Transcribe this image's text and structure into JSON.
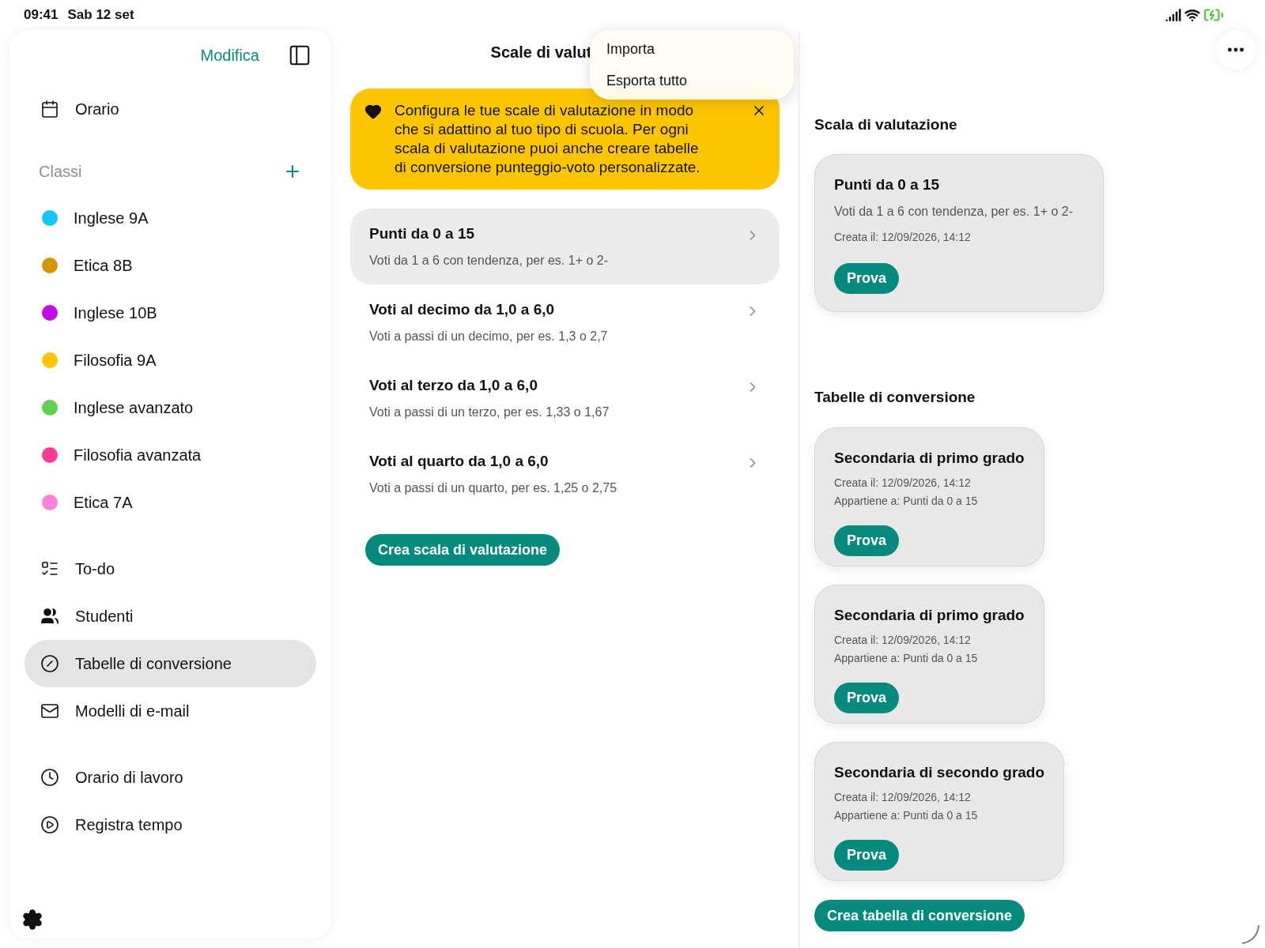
{
  "status_bar": {
    "time": "09:41",
    "date": "Sab 12 set"
  },
  "sidebar": {
    "edit_label": "Modifica",
    "top_items": [
      {
        "label": "Orario",
        "selected": false
      }
    ],
    "classes_heading": "Classi",
    "classes": [
      {
        "label": "Inglese 9A",
        "color": "#12c5fb",
        "selected": false
      },
      {
        "label": "Etica 8B",
        "color": "#d29506",
        "selected": false
      },
      {
        "label": "Inglese 10B",
        "color": "#c10ce6",
        "selected": false
      },
      {
        "label": "Filosofia 9A",
        "color": "#fec504",
        "selected": false
      },
      {
        "label": "Inglese avanzato",
        "color": "#62d052",
        "selected": false
      },
      {
        "label": "Filosofia avanzata",
        "color": "#fc3b94",
        "selected": false
      },
      {
        "label": "Etica 7A",
        "color": "#fc83d8",
        "selected": false
      }
    ],
    "tool_items": [
      {
        "label": "To-do",
        "selected": false
      },
      {
        "label": "Studenti",
        "selected": false
      },
      {
        "label": "Tabelle di conversione",
        "selected": true
      },
      {
        "label": "Modelli di e-mail",
        "selected": false
      }
    ],
    "time_items": [
      {
        "label": "Orario di lavoro",
        "selected": false
      },
      {
        "label": "Registra tempo",
        "selected": false
      }
    ]
  },
  "middle": {
    "title": "Scale di valut",
    "banner": {
      "text": "Configura le tue scale di valutazione in modo che si adattino al tuo tipo di scuola. Per ogni scala di valutazione puoi anche creare tabelle di conversione punteggio-voto personalizzate."
    },
    "scales": [
      {
        "title": "Punti da 0 a 15",
        "description": "Voti da 1 a 6 con tendenza, per es. 1+ o 2-",
        "selected": true
      },
      {
        "title": "Voti al decimo da 1,0 a 6,0",
        "description": "Voti a passi di un decimo, per es. 1,3 o 2,7",
        "selected": false
      },
      {
        "title": "Voti al terzo da 1,0 a 6,0",
        "description": "Voti a passi di un terzo, per es. 1,33 o 1,67",
        "selected": false
      },
      {
        "title": "Voti al quarto da 1,0 a 6,0",
        "description": "Voti a passi di un quarto, per es. 1,25 o 2,75",
        "selected": false
      }
    ],
    "create_button": "Crea scala di valutazione"
  },
  "menu": {
    "items": [
      "Importa",
      "Esporta tutto"
    ]
  },
  "detail": {
    "scale_heading": "Scala di valutazione",
    "scale_card": {
      "title": "Punti da 0 a 15",
      "description": "Voti da 1 a 6 con tendenza, per es. 1+ o 2-",
      "created": "Creata il: 12/09/2026, 14:12",
      "button": "Prova"
    },
    "tables_heading": "Tabelle di conversione",
    "tables": [
      {
        "title": "Secondaria di primo grado",
        "created": "Creata il: 12/09/2026, 14:12",
        "belongs": "Appartiene a: Punti da 0 a 15",
        "button": "Prova"
      },
      {
        "title": "Secondaria di primo grado",
        "created": "Creata il: 12/09/2026, 14:12",
        "belongs": "Appartiene a: Punti da 0 a 15",
        "button": "Prova"
      },
      {
        "title": "Secondaria di secondo grado",
        "created": "Creata il: 12/09/2026, 14:12",
        "belongs": "Appartiene a: Punti da 0 a 15",
        "button": "Prova"
      }
    ],
    "create_button": "Crea tabella di conversione"
  }
}
